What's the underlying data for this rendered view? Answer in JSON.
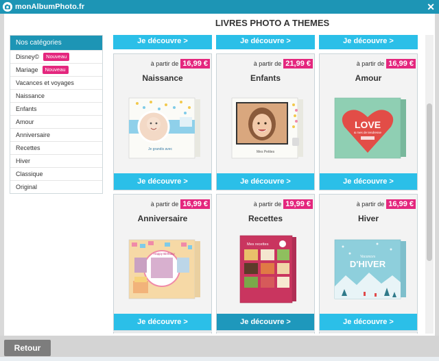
{
  "window": {
    "app_name": "monAlbumPhoto.fr",
    "close_label": "✕"
  },
  "page": {
    "title": "LIVRES PHOTO A THEMES"
  },
  "sidebar": {
    "header": "Nos catégories",
    "items": [
      {
        "label": "Disney©",
        "badge": "Nouveau"
      },
      {
        "label": "Mariage",
        "badge": "Nouveau"
      },
      {
        "label": "Vacances et voyages"
      },
      {
        "label": "Naissance"
      },
      {
        "label": "Enfants"
      },
      {
        "label": "Amour"
      },
      {
        "label": "Anniversaire"
      },
      {
        "label": "Recettes"
      },
      {
        "label": "Hiver"
      },
      {
        "label": "Classique"
      },
      {
        "label": "Original"
      }
    ]
  },
  "products": {
    "top_buttons": [
      "Je découvre >",
      "Je découvre >",
      "Je découvre >"
    ],
    "cards": [
      {
        "from": "à partir de",
        "price": "16,99 €",
        "name": "Naissance",
        "cta": "Je découvre >"
      },
      {
        "from": "à partir de",
        "price": "21,99 €",
        "name": "Enfants",
        "cta": "Je découvre >"
      },
      {
        "from": "à partir de",
        "price": "16,99 €",
        "name": "Amour",
        "cta": "Je découvre >"
      },
      {
        "from": "à partir de",
        "price": "16,99 €",
        "name": "Anniversaire",
        "cta": "Je découvre >"
      },
      {
        "from": "à partir de",
        "price": "19,99 €",
        "name": "Recettes",
        "cta": "Je découvre >"
      },
      {
        "from": "à partir de",
        "price": "16,99 €",
        "name": "Hiver",
        "cta": "Je découvre >"
      }
    ],
    "cover_texts": {
      "naissance": "Je grandis avec",
      "enfants": "Mes Petites",
      "amour_big": "LOVE",
      "amour_sub": "& mes de tendresse",
      "anniversaire": "Happy Birthday",
      "recettes": "Mes recettes",
      "hiver_line1": "Vacances",
      "hiver_line2": "D'HIVER"
    }
  },
  "footer": {
    "back_label": "Retour"
  },
  "colors": {
    "brand": "#1d95b5",
    "cta": "#2bbfe8",
    "price": "#e4277e",
    "badge": "#e4277e"
  }
}
